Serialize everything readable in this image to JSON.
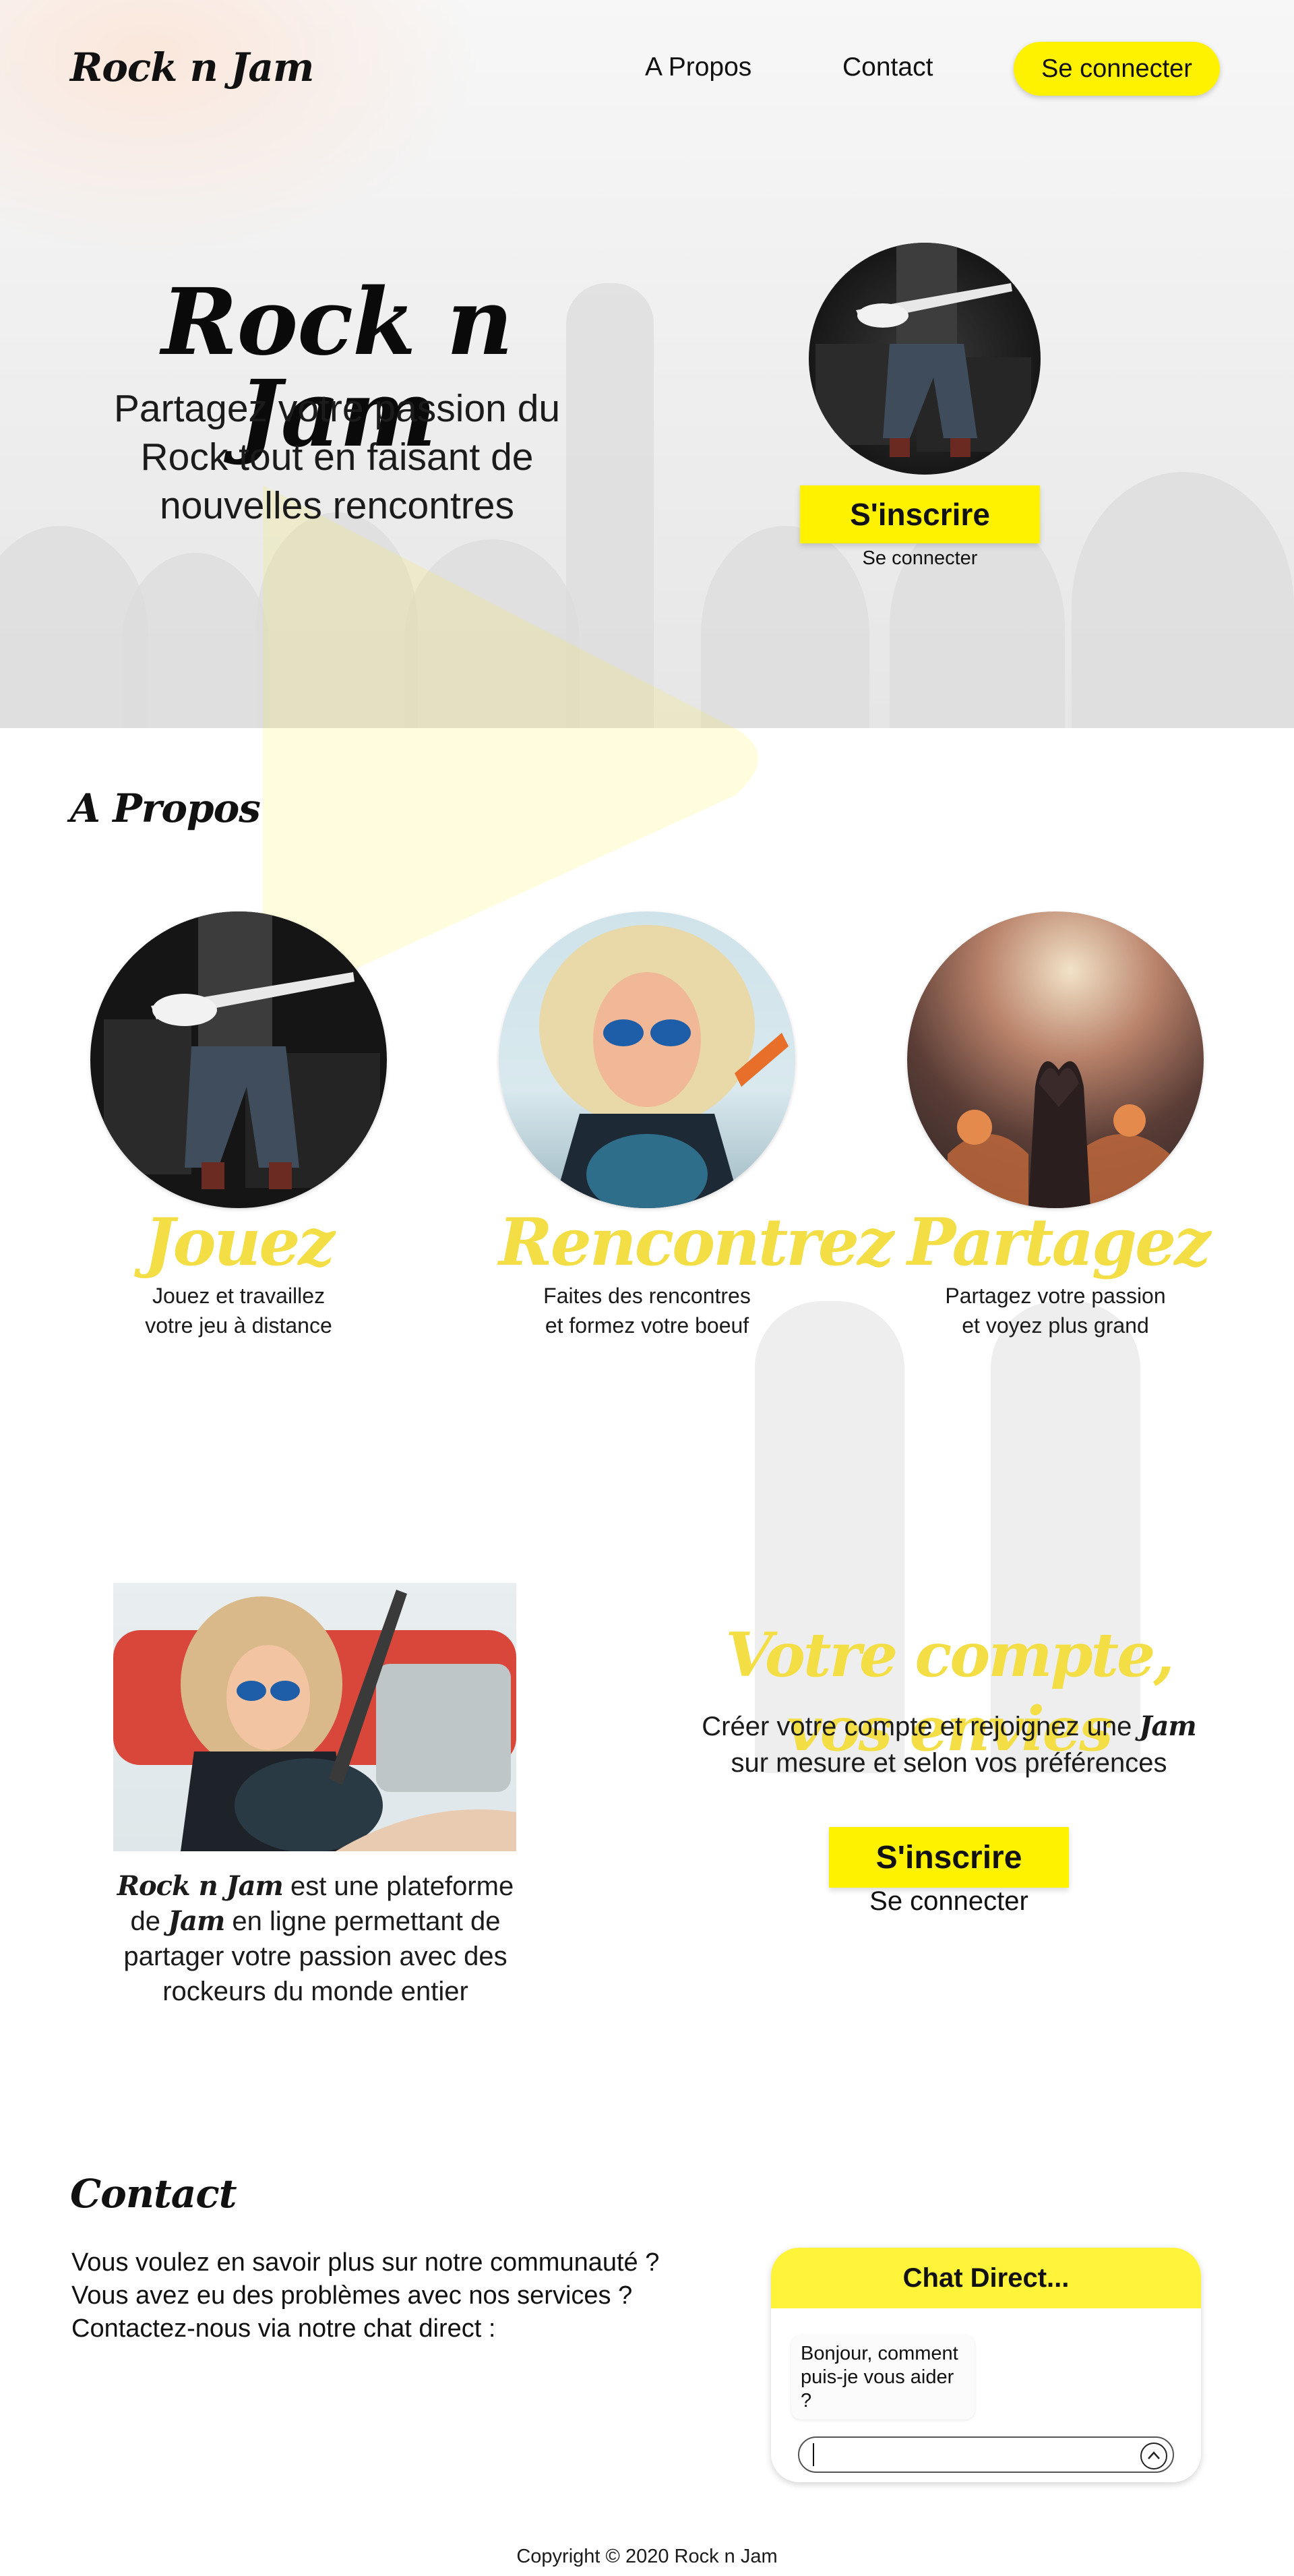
{
  "nav": {
    "logo": "Rock n Jam",
    "links": [
      "A Propos",
      "Contact"
    ],
    "login_button": "Se connecter"
  },
  "hero": {
    "title": "Rock n Jam",
    "tagline": "Partagez votre passion du Rock tout en faisant de nouvelles rencontres",
    "signup_button": "S'inscrire",
    "login_link": "Se connecter"
  },
  "about": {
    "heading": "A Propos",
    "features": [
      {
        "title": "Jouez",
        "desc_line1": "Jouez et travaillez",
        "desc_line2": "votre jeu à distance"
      },
      {
        "title": "Rencontrez",
        "desc_line1": "Faites des rencontres",
        "desc_line2": "et formez votre boeuf"
      },
      {
        "title": "Partagez",
        "desc_line1": "Partagez votre passion",
        "desc_line2": "et voyez plus grand"
      }
    ]
  },
  "account": {
    "brand": "Rock n Jam",
    "platform_text_1": " est une plateforme de ",
    "jam_word": "Jam",
    "platform_text_2": " en ligne permettant de partager votre passion avec des rockeurs du monde entier",
    "heading": "Votre compte, vos envies",
    "desc_1": "Créer votre compte et rejoignez une ",
    "desc_jam": "Jam",
    "desc_2": " sur mesure et selon vos préférences",
    "signup_button": "S'inscrire",
    "login_link": "Se connecter"
  },
  "contact": {
    "heading": "Contact",
    "line1": "Vous voulez en savoir plus sur notre communauté ?",
    "line2": "Vous avez eu des problèmes avec nos services ?",
    "line3": "Contactez-nous via notre chat direct :"
  },
  "chat": {
    "title": "Chat Direct...",
    "bot_message_line1": "Bonjour, comment",
    "bot_message_line2": "puis-je vous aider ?",
    "input_value": "",
    "send_icon": "chevron-up-icon"
  },
  "footer": {
    "copyright": "Copyright © 2020 Rock n Jam"
  },
  "colors": {
    "accent": "#fff200",
    "accent_text": "#f4de45",
    "text": "#111111"
  }
}
